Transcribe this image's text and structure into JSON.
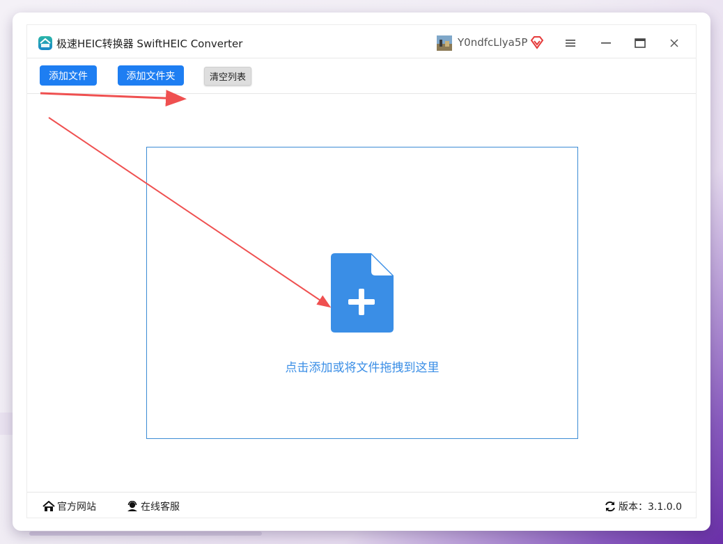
{
  "window": {
    "title": "极速HEIC转换器 SwiftHEIC Converter",
    "username": "Y0ndfcLlya5P"
  },
  "toolbar": {
    "add_file_label": "添加文件",
    "add_folder_label": "添加文件夹",
    "clear_list_label": "清空列表"
  },
  "dropzone": {
    "hint": "点击添加或将文件拖拽到这里"
  },
  "footer": {
    "website_label": "官方网站",
    "service_label": "在线客服",
    "version_label": "版本：3.1.0.0"
  },
  "colors": {
    "accent": "#1e7ef2",
    "dropzone_border": "#3b8bd4",
    "file_icon": "#3a8ee6",
    "annotation_arrow": "#ef5050"
  },
  "icons": {
    "logo": "heic-logo-icon",
    "vip": "vip-diamond-icon",
    "menu": "hamburger-icon",
    "minimize": "minimize-icon",
    "maximize": "maximize-icon",
    "close": "close-icon",
    "file_add": "file-add-icon",
    "home": "home-icon",
    "service": "customer-service-icon",
    "refresh": "refresh-icon"
  }
}
